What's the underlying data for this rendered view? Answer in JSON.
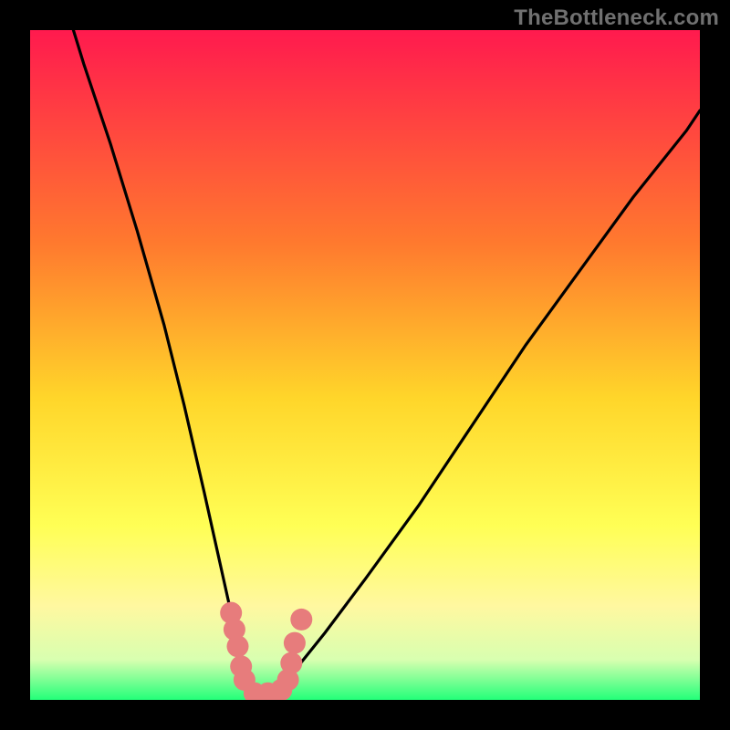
{
  "watermark": "TheBottleneck.com",
  "colors": {
    "gradient_top": "#ff1a4e",
    "gradient_mid1": "#ff7a2e",
    "gradient_mid2": "#ffd62a",
    "gradient_mid3": "#ffff55",
    "gradient_low1": "#fff8a0",
    "gradient_low2": "#d8ffb0",
    "gradient_bottom": "#23ff79",
    "frame": "#000000",
    "curve": "#000000",
    "marker": "#e77c7c"
  },
  "chart_data": {
    "type": "line",
    "title": "",
    "xlabel": "",
    "ylabel": "",
    "xlim": [
      0,
      100
    ],
    "ylim": [
      0,
      100
    ],
    "series": [
      {
        "name": "bottleneck-curve",
        "x": [
          0,
          4,
          8,
          12,
          16,
          20,
          23,
          26,
          28,
          30,
          31,
          32,
          33,
          34,
          35,
          36,
          37,
          38,
          40,
          44,
          50,
          58,
          66,
          74,
          82,
          90,
          98,
          100
        ],
        "y": [
          120,
          108,
          95,
          83,
          70,
          56,
          44,
          31,
          22,
          13,
          8,
          5,
          2,
          1,
          1,
          1,
          2,
          3,
          5,
          10,
          18,
          29,
          41,
          53,
          64,
          75,
          85,
          88
        ]
      }
    ],
    "markers": [
      {
        "x": 30.0,
        "y": 13.0
      },
      {
        "x": 30.5,
        "y": 10.5
      },
      {
        "x": 31.0,
        "y": 8.0
      },
      {
        "x": 31.5,
        "y": 5.0
      },
      {
        "x": 32.0,
        "y": 3.0
      },
      {
        "x": 33.5,
        "y": 1.0
      },
      {
        "x": 35.5,
        "y": 1.0
      },
      {
        "x": 37.5,
        "y": 1.5
      },
      {
        "x": 38.5,
        "y": 3.0
      },
      {
        "x": 39.0,
        "y": 5.5
      },
      {
        "x": 39.5,
        "y": 8.5
      },
      {
        "x": 40.5,
        "y": 12.0
      }
    ],
    "annotations": []
  }
}
